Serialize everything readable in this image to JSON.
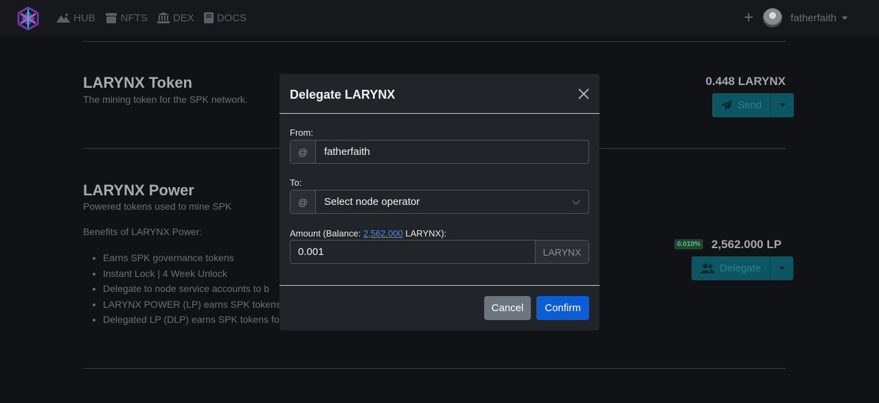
{
  "nav": {
    "links": [
      {
        "label": "HUB",
        "icon": "mountain-icon"
      },
      {
        "label": "NFTS",
        "icon": "store-icon"
      },
      {
        "label": "DEX",
        "icon": "bank-icon"
      },
      {
        "label": "DOCS",
        "icon": "book-icon"
      }
    ],
    "plus": "+",
    "username": "fatherfaith"
  },
  "token_section": {
    "title": "LARYNX Token",
    "subtitle": "The mining token for the SPK network.",
    "balance": "0.448 LARYNX",
    "send_label": "Send"
  },
  "power_section": {
    "title": "LARYNX Power",
    "subtitle": "Powered tokens used to mine SPK",
    "benefits_heading": "Benefits of LARYNX Power:",
    "benefits": [
      "Earns SPK governance tokens",
      "Instant Lock | 4 Week Unlock",
      "Delegate to node service accounts to b",
      "LARYNX POWER (LP) earns SPK tokens",
      "Delegated LP (DLP) earns SPK tokens fo"
    ],
    "percent_badge": "0.010%",
    "balance": "2,562.000 LP",
    "delegate_label": "Delegate"
  },
  "modal": {
    "title": "Delegate LARYNX",
    "from_label": "From:",
    "from_prefix": "@",
    "from_value": "fatherfaith",
    "to_label": "To:",
    "to_prefix": "@",
    "to_selected": "Select node operator",
    "amount_label_pre": "Amount (Balance: ",
    "amount_balance": "2,562.000",
    "amount_label_post": " LARYNX):",
    "amount_value": "0.001",
    "amount_unit": "LARYNX",
    "cancel_label": "Cancel",
    "confirm_label": "Confirm"
  },
  "colors": {
    "accent_teal": "#0c5562",
    "confirm_blue": "#0b5ed7",
    "cancel_gray": "#6c757d",
    "link_blue": "#4d8fea"
  }
}
